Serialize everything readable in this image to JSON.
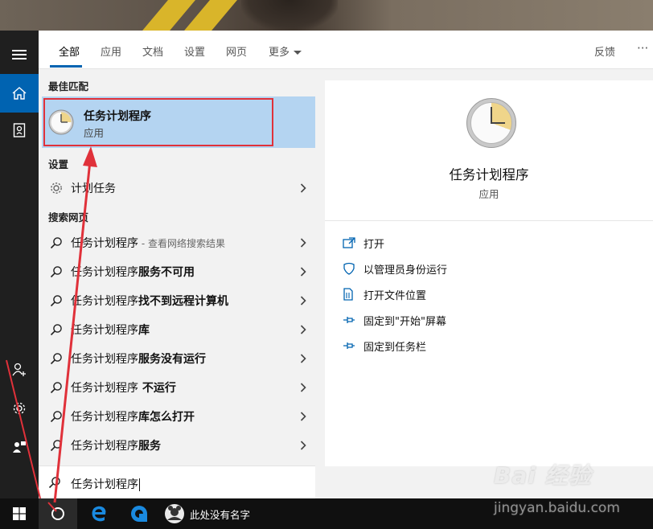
{
  "tabs": [
    {
      "label": "全部"
    },
    {
      "label": "应用"
    },
    {
      "label": "文档"
    },
    {
      "label": "设置"
    },
    {
      "label": "网页"
    },
    {
      "label": "更多"
    }
  ],
  "feedback_label": "反馈",
  "more_options_label": "···",
  "sections": {
    "best_match": "最佳匹配",
    "settings": "设置",
    "web": "搜索网页"
  },
  "best_match": {
    "title": "任务计划程序",
    "subtitle": "应用"
  },
  "settings_items": [
    {
      "label": "计划任务"
    }
  ],
  "web_results": [
    {
      "base": "任务计划程序",
      "bold": "",
      "hint": " - 查看网络搜索结果"
    },
    {
      "base": "任务计划程序",
      "bold": "服务不可用",
      "hint": ""
    },
    {
      "base": "任务计划程序",
      "bold": "找不到远程计算机",
      "hint": ""
    },
    {
      "base": "任务计划程序",
      "bold": "库",
      "hint": ""
    },
    {
      "base": "任务计划程序",
      "bold": "服务没有运行",
      "hint": ""
    },
    {
      "base": "任务计划程序",
      "bold": " 不运行",
      "hint": ""
    },
    {
      "base": "任务计划程序",
      "bold": "库怎么打开",
      "hint": ""
    },
    {
      "base": "任务计划程序",
      "bold": "服务",
      "hint": ""
    }
  ],
  "search": {
    "value": "任务计划程序"
  },
  "preview": {
    "title": "任务计划程序",
    "subtitle": "应用",
    "actions": [
      {
        "label": "打开",
        "icon": "open-icon"
      },
      {
        "label": "以管理员身份运行",
        "icon": "shield-icon"
      },
      {
        "label": "打开文件位置",
        "icon": "file-location-icon"
      },
      {
        "label": "固定到\"开始\"屏幕",
        "icon": "pin-icon"
      },
      {
        "label": "固定到任务栏",
        "icon": "pin-icon"
      }
    ]
  },
  "taskbar": {
    "user_label": "此处没有名字"
  },
  "watermark": {
    "logo": "Bai 经验",
    "url": "jingyan.baidu.com"
  },
  "colors": {
    "accent": "#0063b1",
    "highlight": "#b4d4f1",
    "annotation": "#e0313a"
  }
}
